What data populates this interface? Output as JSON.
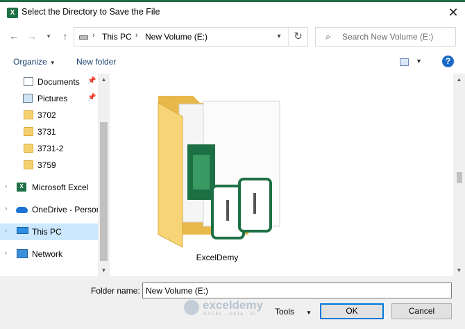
{
  "window": {
    "title": "Select the Directory to Save the File",
    "app_icon_letter": "X",
    "close_glyph": "✕"
  },
  "address": {
    "crumbs": [
      "This PC",
      "New Volume (E:)"
    ],
    "search_placeholder": "Search New Volume (E:)"
  },
  "commands": {
    "organize": "Organize",
    "new_folder": "New folder",
    "help": "?"
  },
  "nav_items": [
    {
      "label": "Documents",
      "icon": "documents-icon",
      "pinned": true
    },
    {
      "label": "Pictures",
      "icon": "pictures-icon",
      "pinned": true
    },
    {
      "label": "3702",
      "icon": "folder-icon"
    },
    {
      "label": "3731",
      "icon": "folder-icon"
    },
    {
      "label": "3731-2",
      "icon": "folder-icon"
    },
    {
      "label": "3759",
      "icon": "folder-icon"
    },
    {
      "label": "Microsoft Excel",
      "icon": "excel-icon",
      "expandable": true
    },
    {
      "label": "OneDrive - Person",
      "icon": "onedrive-icon",
      "expandable": true
    },
    {
      "label": "This PC",
      "icon": "this-pc-icon",
      "expandable": true,
      "selected": true
    },
    {
      "label": "Network",
      "icon": "network-icon",
      "expandable": true
    }
  ],
  "content": {
    "folder_label": "ExcelDemy"
  },
  "footer": {
    "folder_name_label": "Folder name:",
    "folder_name_value": "New Volume (E:)",
    "tools_label": "Tools",
    "ok_label": "OK",
    "cancel_label": "Cancel"
  },
  "watermark": {
    "name": "exceldemy",
    "tagline": "EXCEL · DATA · BI"
  },
  "colors": {
    "accent": "#0078d7",
    "selection": "#cce8ff",
    "excel_green": "#1d7044",
    "link": "#1a3f6f"
  }
}
